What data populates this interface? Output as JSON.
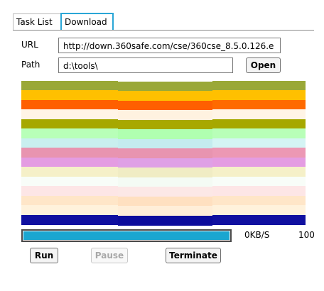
{
  "tabs": {
    "task_list": "Task List",
    "download": "Download"
  },
  "form": {
    "url_label": "URL",
    "url_value": "http://down.360safe.com/cse/360cse_8.5.0.126.e",
    "path_label": "Path",
    "path_value": "d:\\tools\\",
    "open_label": "Open"
  },
  "segments_colors": [
    [
      "#9aa837",
      "#9aa837",
      "#9aa837"
    ],
    [
      "#ffc000",
      "#ffc000",
      "#ffc000"
    ],
    [
      "#ff5f00",
      "#ff5f00",
      "#ff6a00"
    ],
    [
      "#fff4e6",
      "#fff2e0",
      "#fff4e6"
    ],
    [
      "#a6a800",
      "#a8a800",
      "#a6a800"
    ],
    [
      "#b8ffb8",
      "#b0ffb0",
      "#b8ffb8"
    ],
    [
      "#c9efef",
      "#c4ecef",
      "#d4f4f4"
    ],
    [
      "#e894b0",
      "#e894b0",
      "#ec98b4"
    ],
    [
      "#e49ce2",
      "#dfa0e6",
      "#e49ce2"
    ],
    [
      "#f5f0c8",
      "#f0ecc4",
      "#f5f0c8"
    ],
    [
      "#f8fdf8",
      "#f4fbf4",
      "#f8fdf8"
    ],
    [
      "#fde6e6",
      "#fce8e6",
      "#fde6e6"
    ],
    [
      "#ffe6c8",
      "#ffe0c0",
      "#ffe6c8"
    ],
    [
      "#fff2dc",
      "#ffeed8",
      "#fff2dc"
    ],
    [
      "#1010a0",
      "#0c0c9c",
      "#1010a0"
    ]
  ],
  "progress": {
    "fraction": 1.0,
    "speed": "0KB/S",
    "percent": "100"
  },
  "buttons": {
    "run": "Run",
    "pause": "Pause",
    "terminate": "Terminate"
  }
}
